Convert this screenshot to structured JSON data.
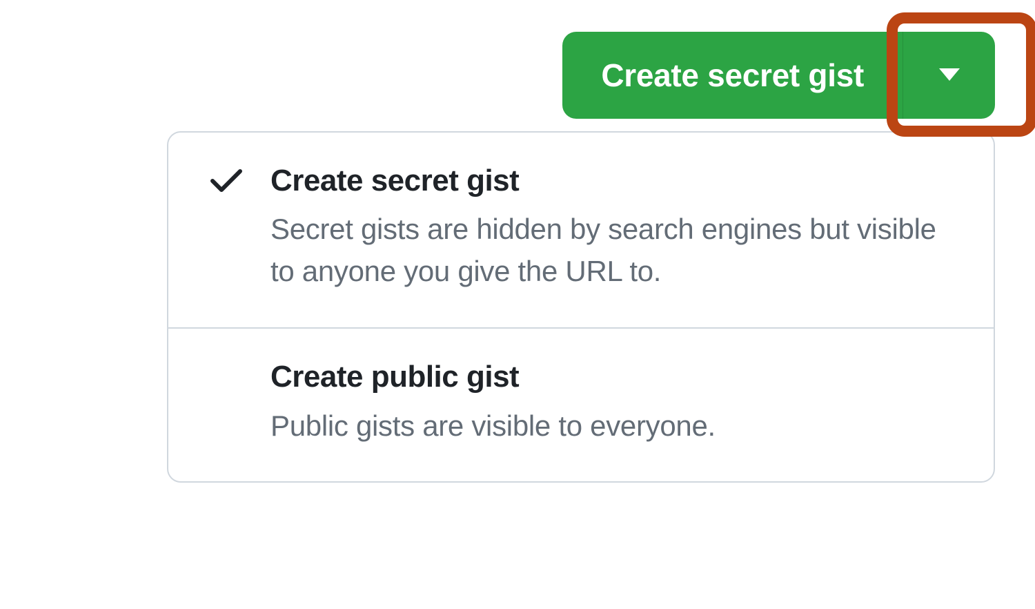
{
  "button": {
    "primary_label": "Create secret gist"
  },
  "dropdown": {
    "options": [
      {
        "title": "Create secret gist",
        "description": "Secret gists are hidden by search engines but visible to anyone you give the URL to.",
        "selected": true
      },
      {
        "title": "Create public gist",
        "description": "Public gists are visible to everyone.",
        "selected": false
      }
    ]
  }
}
